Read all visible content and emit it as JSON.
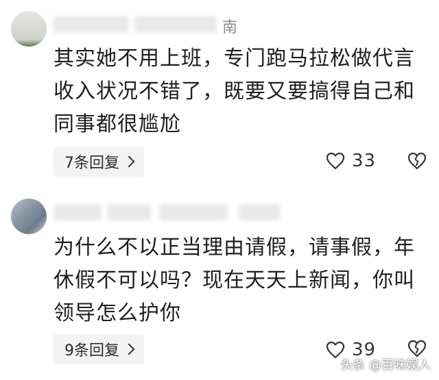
{
  "comments": [
    {
      "name_suffix": "南",
      "text_lines": [
        "其实她不用上班，专门跑马拉松做代言",
        "收入状况不错了，既要又要搞得自己和",
        "同事都很尴尬"
      ],
      "reply_label": "7条回复",
      "like_count": "33"
    },
    {
      "name_suffix": "",
      "text_lines": [
        "为什么不以正当理由请假，请事假，年",
        "休假不可以吗？现在天天上新闻，你叫",
        "领导怎么护你"
      ],
      "reply_label": "9条回复",
      "like_count": "39"
    }
  ],
  "watermark": "头条 @百味娱人"
}
